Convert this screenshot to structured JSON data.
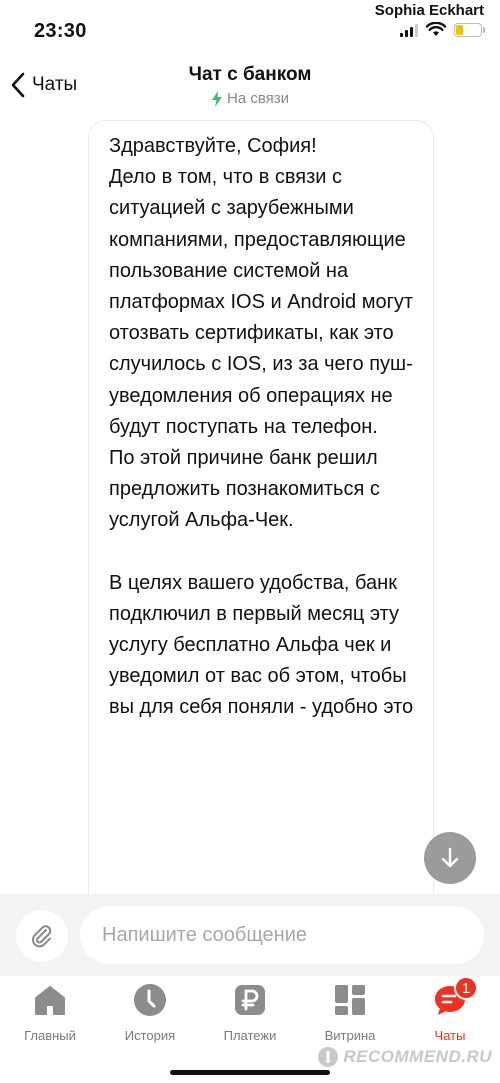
{
  "status_bar": {
    "time": "23:30",
    "user_name": "Sophia Eckhart",
    "battery_level": 0.25
  },
  "header": {
    "back_label": "Чаты",
    "title": "Чат с банком",
    "subtitle": "На связи"
  },
  "message": {
    "paragraphs": [
      "Здравствуйте, София!\nДело в том, что в связи с ситуацией с зарубежными компаниями, предоставляющие пользование системой на платформах IOS и Android могут отозвать сертификаты, как это случилось с IOS, из за чего пуш-уведомления об операциях не будут поступать на телефон.\nПо этой причине банк решил предложить познакомиться с услугой Альфа-Чек.",
      "В целях вашего удобства, банк подключил в первый месяц эту услугу бесплатно Альфа чек и уведомил от вас об этом, чтобы вы для себя поняли - удобно это"
    ]
  },
  "composer": {
    "placeholder": "Напишите сообщение"
  },
  "tabs": [
    {
      "label": "Главный",
      "icon": "home-icon"
    },
    {
      "label": "История",
      "icon": "clock-icon"
    },
    {
      "label": "Платежи",
      "icon": "ruble-icon"
    },
    {
      "label": "Витрина",
      "icon": "grid-icon"
    },
    {
      "label": "Чаты",
      "icon": "chat-bubble-icon",
      "active": true,
      "badge": "1"
    }
  ],
  "watermark": "RECOMMEND.RU",
  "colors": {
    "accent": "#ef3124",
    "online": "#2fbf71",
    "muted": "#9b9b9b"
  }
}
